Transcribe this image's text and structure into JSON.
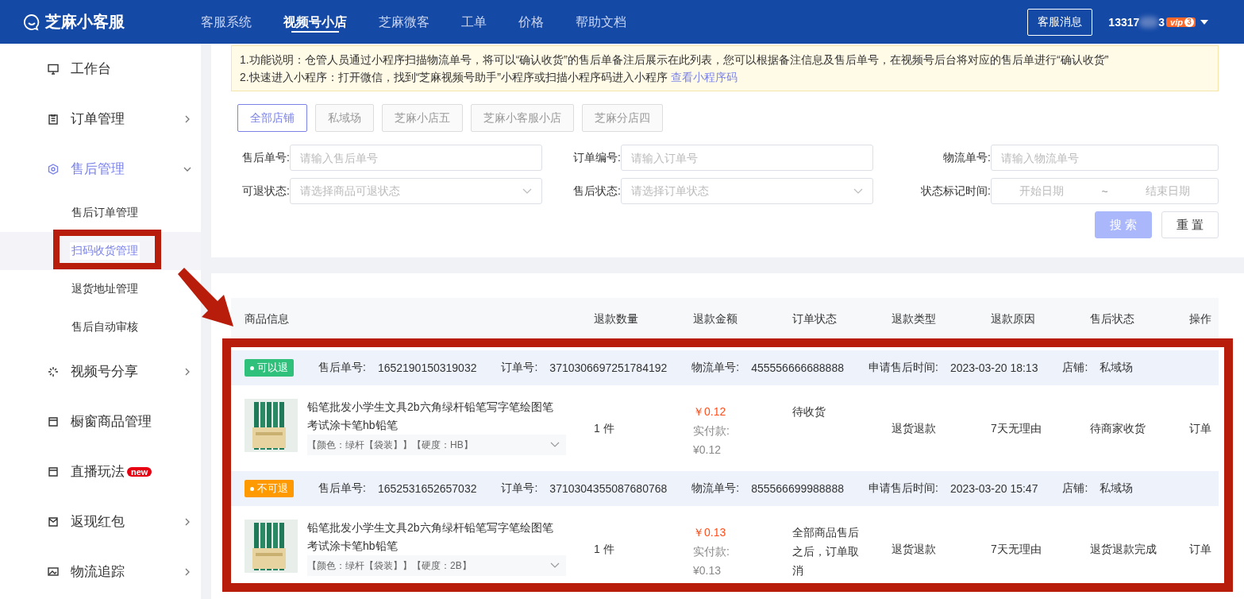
{
  "header": {
    "logo": "芝麻小客服",
    "nav": [
      {
        "label": "客服系统",
        "selected": false
      },
      {
        "label": "视频号小店",
        "selected": true
      },
      {
        "label": "芝麻微客",
        "selected": false
      },
      {
        "label": "工单",
        "selected": false
      },
      {
        "label": "价格",
        "selected": false
      },
      {
        "label": "帮助文档",
        "selected": false
      }
    ],
    "message_button": "客服消息",
    "account": "13317",
    "account_tail": "3",
    "vip": "vip",
    "vip_level": "3"
  },
  "sidebar": {
    "items": [
      {
        "label": "工作台",
        "expandable": false,
        "expanded": false
      },
      {
        "label": "订单管理",
        "expandable": true,
        "expanded": false
      },
      {
        "label": "售后管理",
        "expandable": true,
        "expanded": true,
        "children": [
          {
            "label": "售后订单管理",
            "selected": false
          },
          {
            "label": "扫码收货管理",
            "selected": true
          },
          {
            "label": "退货地址管理",
            "selected": false
          },
          {
            "label": "售后自动审核",
            "selected": false
          }
        ]
      },
      {
        "label": "视频号分享",
        "expandable": true,
        "expanded": false
      },
      {
        "label": "橱窗商品管理",
        "expandable": false,
        "expanded": false
      },
      {
        "label": "直播玩法",
        "expandable": false,
        "expanded": false,
        "badge": "new"
      },
      {
        "label": "返现红包",
        "expandable": true,
        "expanded": false
      },
      {
        "label": "物流追踪",
        "expandable": true,
        "expanded": false
      }
    ]
  },
  "notice": {
    "line_1": "1.功能说明：仓管人员通过小程序扫描物流单号，将可以“确认收货”的售后单备注后展示在此列表，您可以根据备注信息及售后单号，在视频号后台将对应的售后单进行“确认收货”",
    "line_2": "2.快速进入小程序：打开微信，找到“芝麻视频号助手”小程序或扫描小程序码进入小程序",
    "line_2_link": "查看小程序码"
  },
  "stores": [
    {
      "label": "全部店铺",
      "selected": true
    },
    {
      "label": "私域场",
      "selected": false
    },
    {
      "label": "芝麻小店五",
      "selected": false
    },
    {
      "label": "芝麻小客服小店",
      "selected": false
    },
    {
      "label": "芝麻分店四",
      "selected": false
    }
  ],
  "filters": [
    {
      "kind": "input",
      "label": "售后单号:",
      "placeholder": "请输入售后单号"
    },
    {
      "kind": "input",
      "label": "订单编号:",
      "placeholder": "请输入订单号"
    },
    {
      "kind": "input",
      "label": "物流单号:",
      "placeholder": "请输入物流单号"
    },
    {
      "kind": "select",
      "label": "可退状态:",
      "placeholder": "请选择商品可退状态"
    },
    {
      "kind": "select",
      "label": "售后状态:",
      "placeholder": "请选择订单状态"
    },
    {
      "kind": "daterange",
      "label": "状态标记时间:",
      "start_placeholder": "开始日期",
      "separator": "~",
      "end_placeholder": "结束日期"
    }
  ],
  "buttons": {
    "search": {
      "label": "搜 索",
      "disabled": true
    },
    "reset": {
      "label": "重 置"
    }
  },
  "table": {
    "columns": [
      "商品信息",
      "退款数量",
      "退款金额",
      "订单状态",
      "退款类型",
      "退款原因",
      "售后状态",
      "操作"
    ],
    "groups": [
      {
        "tag": {
          "label": "可以退",
          "color": "#2fc17c"
        },
        "fields": [
          {
            "label": "售后单号:",
            "value": "1652190150319032"
          },
          {
            "label": "订单号:",
            "value": "3710306697251784192"
          },
          {
            "label": "物流单号:",
            "value": "455556666688888"
          },
          {
            "label": "申请售后时间:",
            "value": "2023-03-20 18:13"
          },
          {
            "label": "店铺:",
            "value": "私域场"
          }
        ],
        "product": {
          "title": "铅笔批发小学生文具2b六角绿杆铅笔写字笔绘图笔考试涂卡笔hb铅笔",
          "spec": "【颜色：绿杆【袋装】】【硬度：HB】",
          "quantity": "1 件",
          "price": "￥0.12",
          "paid_label": "实付款:",
          "paid": "¥0.12",
          "order_status": "待收货",
          "refund_type": "退货退款",
          "reason": "7天无理由",
          "after_sale_status": "待商家收货",
          "action": "订单"
        }
      },
      {
        "tag": {
          "label": "不可退",
          "color": "#ff9900"
        },
        "fields": [
          {
            "label": "售后单号:",
            "value": "1652531652657032"
          },
          {
            "label": "订单号:",
            "value": "3710304355087680768"
          },
          {
            "label": "物流单号:",
            "value": "855566699988888"
          },
          {
            "label": "申请售后时间:",
            "value": "2023-03-20 15:47"
          },
          {
            "label": "店铺:",
            "value": "私域场"
          }
        ],
        "product": {
          "title": "铅笔批发小学生文具2b六角绿杆铅笔写字笔绘图笔考试涂卡笔hb铅笔",
          "spec": "【颜色：绿杆【袋装】】【硬度：2B】",
          "quantity": "1 件",
          "price": "￥0.13",
          "paid_label": "实付款:",
          "paid": "¥0.13",
          "order_status": "全部商品售后之后，订单取消",
          "refund_type": "退货退款",
          "reason": "7天无理由",
          "after_sale_status": "退货退款完成",
          "action": "订单"
        }
      }
    ]
  }
}
